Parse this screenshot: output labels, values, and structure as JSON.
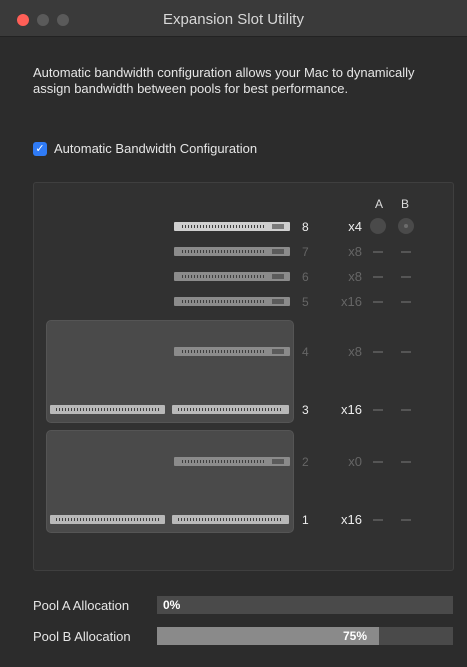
{
  "window": {
    "title": "Expansion Slot Utility"
  },
  "description": "Automatic bandwidth configuration allows your Mac to dynamically assign bandwidth between pools for best performance.",
  "auto_bandwidth": {
    "label": "Automatic Bandwidth Configuration",
    "checked": true
  },
  "columns": {
    "a": "A",
    "b": "B"
  },
  "slots": [
    {
      "number": "8",
      "lanes": "x4"
    },
    {
      "number": "7",
      "lanes": "x8"
    },
    {
      "number": "6",
      "lanes": "x8"
    },
    {
      "number": "5",
      "lanes": "x16"
    },
    {
      "number": "4",
      "lanes": "x8"
    },
    {
      "number": "3",
      "lanes": "x16"
    },
    {
      "number": "2",
      "lanes": "x0"
    },
    {
      "number": "1",
      "lanes": "x16"
    }
  ],
  "pool_a": {
    "label": "Pool A Allocation",
    "value": "0%",
    "fraction": 0.0
  },
  "pool_b": {
    "label": "Pool B Allocation",
    "value": "75%",
    "fraction": 0.75
  },
  "icons": {
    "check": "checkmark-icon",
    "radio": "radio-button-icon"
  }
}
